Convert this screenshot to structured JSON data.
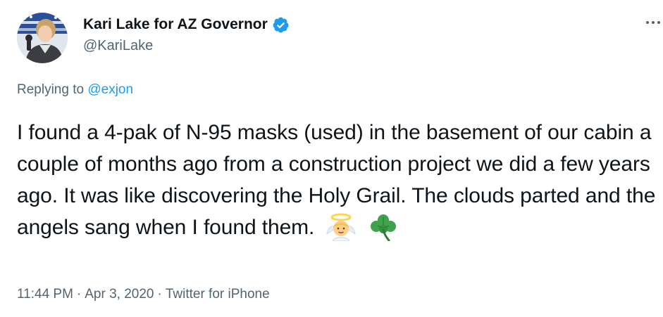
{
  "tweet": {
    "author": {
      "display_name": "Kari Lake for AZ Governor",
      "handle": "@KariLake",
      "verified": true,
      "verified_color": "#1d9bf0"
    },
    "reply": {
      "prefix": "Replying to ",
      "to_handle": "@exjon"
    },
    "text": "I found a 4-pak of N-95 masks (used) in the basement of our cabin a couple of months ago from a construction project we did a few years ago. It was like discovering the Holy Grail. The clouds parted and the angels sang when I found them.",
    "emojis": [
      "angel-emoji",
      "shamrock-emoji"
    ],
    "meta": {
      "time": "11:44 PM",
      "separator": "·",
      "date": "Apr 3, 2020",
      "source": "Twitter for iPhone"
    },
    "icons": {
      "more": "more-options-icon"
    }
  },
  "colors": {
    "text_primary": "#0f1419",
    "text_secondary": "#536471",
    "link": "#1d9bf0"
  }
}
